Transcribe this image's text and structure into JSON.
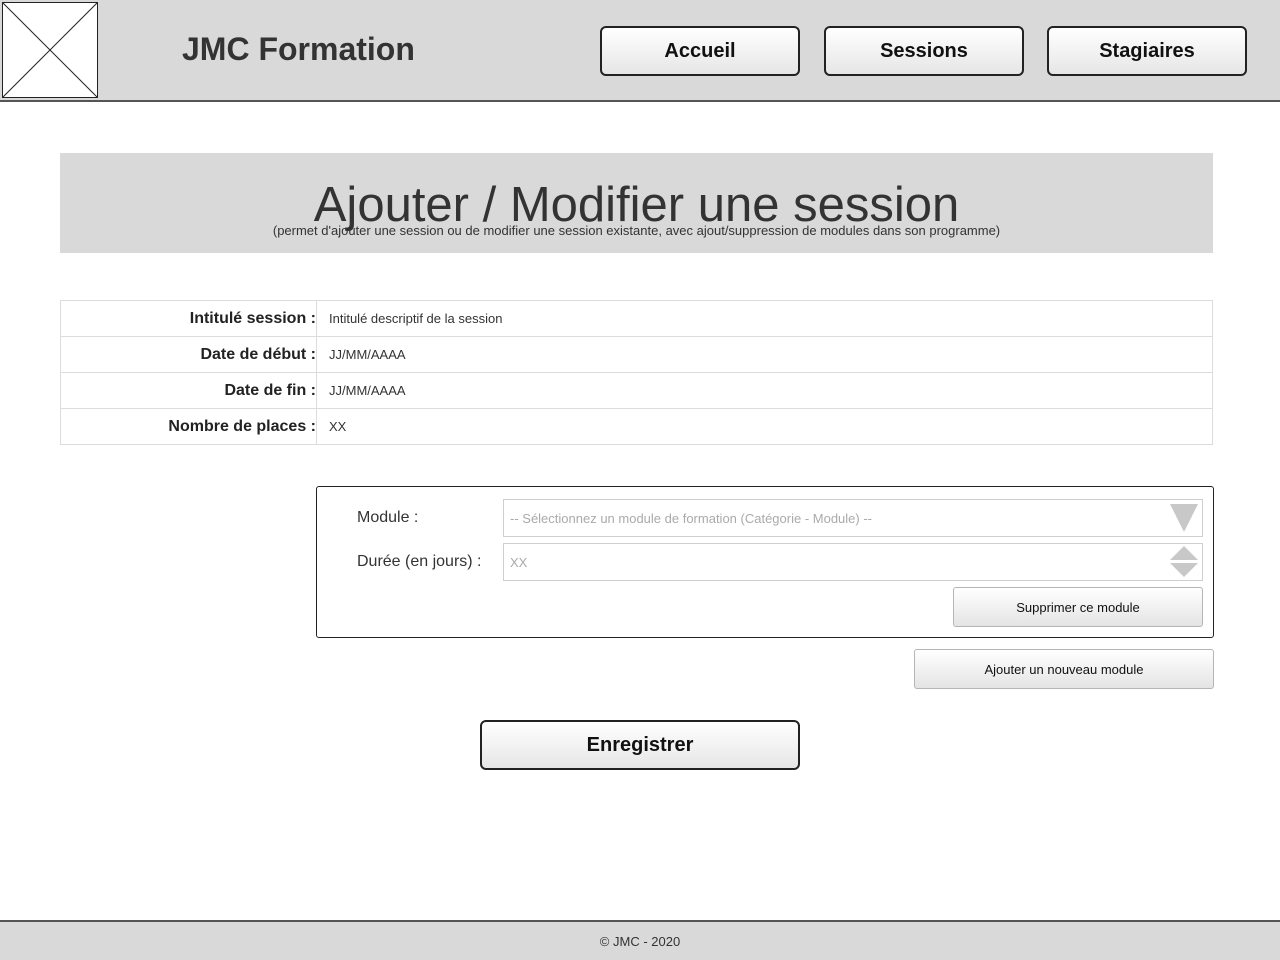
{
  "header": {
    "brand": "JMC Formation",
    "nav": [
      {
        "label": "Accueil"
      },
      {
        "label": "Sessions"
      },
      {
        "label": "Stagiaires"
      }
    ]
  },
  "title": {
    "main": "Ajouter / Modifier une session",
    "subtitle": "(permet d'ajouter une session ou de modifier une session existante, avec ajout/suppression de modules dans son programme)"
  },
  "form": {
    "rows": [
      {
        "label": "Intitulé session :",
        "value": "Intitulé descriptif de la session"
      },
      {
        "label": "Date de début :",
        "value": "JJ/MM/AAAA"
      },
      {
        "label": "Date de fin :",
        "value": "JJ/MM/AAAA"
      },
      {
        "label": "Nombre de places :",
        "value": "XX"
      }
    ]
  },
  "module": {
    "module_label": "Module :",
    "module_placeholder": "-- Sélectionnez un module de formation (Catégorie - Module) --",
    "duration_label": "Durée (en jours) :",
    "duration_placeholder": "XX",
    "delete_label": "Supprimer ce module"
  },
  "add_module_label": "Ajouter un nouveau module",
  "save_label": "Enregistrer",
  "footer": {
    "text": "© JMC - 2020"
  },
  "icons": {
    "logo": "image-placeholder-icon",
    "select_arrow": "chevron-down-icon",
    "spinner": "spinner-arrows-icon"
  }
}
